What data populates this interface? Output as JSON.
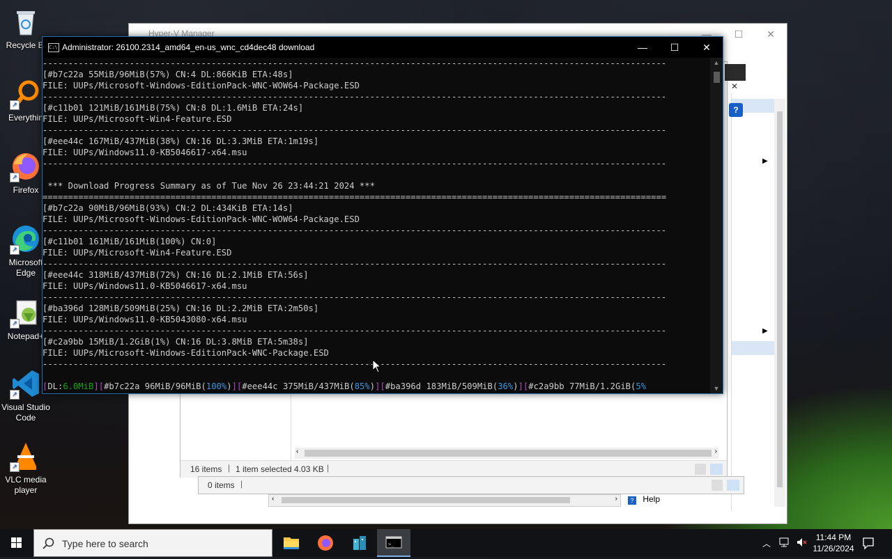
{
  "desktop": {
    "icons": [
      {
        "label": "Recycle Bi",
        "icon": "recycle-bin-icon"
      },
      {
        "label": "Everythin",
        "icon": "everything-search-icon"
      },
      {
        "label": "Firefox",
        "icon": "firefox-icon"
      },
      {
        "label": "Microsoft Edge",
        "icon": "edge-icon"
      },
      {
        "label": "Notepad+",
        "icon": "notepad-plus-icon"
      },
      {
        "label": "Visual Studio Code",
        "icon": "vscode-icon"
      },
      {
        "label": "VLC media player",
        "icon": "vlc-icon"
      }
    ]
  },
  "hyperv": {
    "title": "Hyper-V Manager",
    "status_items": "16 items",
    "status_selected": "1 item selected  4.03 KB",
    "status_items2": "0 items",
    "help_label": "Help"
  },
  "terminal": {
    "title": "Administrator:  26100.2314_amd64_en-us_wnc_cd4dec48 download",
    "lines": [
      "--------------------------------------------------------------------------------------------------------------------------",
      "[#b7c22a 55MiB/96MiB(57%) CN:4 DL:866KiB ETA:48s]",
      "FILE: UUPs/Microsoft-Windows-EditionPack-WNC-WOW64-Package.ESD",
      "--------------------------------------------------------------------------------------------------------------------------",
      "[#c11b01 121MiB/161MiB(75%) CN:8 DL:1.6MiB ETA:24s]",
      "FILE: UUPs/Microsoft-Win4-Feature.ESD",
      "--------------------------------------------------------------------------------------------------------------------------",
      "[#eee44c 167MiB/437MiB(38%) CN:16 DL:3.3MiB ETA:1m19s]",
      "FILE: UUPs/Windows11.0-KB5046617-x64.msu",
      "--------------------------------------------------------------------------------------------------------------------------",
      "",
      " *** Download Progress Summary as of Tue Nov 26 23:44:21 2024 ***",
      "==========================================================================================================================",
      "[#b7c22a 90MiB/96MiB(93%) CN:2 DL:434KiB ETA:14s]",
      "FILE: UUPs/Microsoft-Windows-EditionPack-WNC-WOW64-Package.ESD",
      "--------------------------------------------------------------------------------------------------------------------------",
      "[#c11b01 161MiB/161MiB(100%) CN:0]",
      "FILE: UUPs/Microsoft-Win4-Feature.ESD",
      "--------------------------------------------------------------------------------------------------------------------------",
      "[#eee44c 318MiB/437MiB(72%) CN:16 DL:2.1MiB ETA:56s]",
      "FILE: UUPs/Windows11.0-KB5046617-x64.msu",
      "--------------------------------------------------------------------------------------------------------------------------",
      "[#ba396d 128MiB/509MiB(25%) CN:16 DL:2.2MiB ETA:2m50s]",
      "FILE: UUPs/Windows11.0-KB5043080-x64.msu",
      "--------------------------------------------------------------------------------------------------------------------------",
      "[#c2a9bb 15MiB/1.2GiB(1%) CN:16 DL:3.8MiB ETA:5m38s]",
      "FILE: UUPs/Microsoft-Windows-EditionPack-WNC-Package.ESD",
      "--------------------------------------------------------------------------------------------------------------------------",
      ""
    ],
    "progress": {
      "dl_label": "DL:",
      "dl_value": "6.0MiB",
      "items": [
        {
          "id": "#b7c22a",
          "size": "96MiB/96MiB",
          "pct": "100%"
        },
        {
          "id": "#eee44c",
          "size": "375MiB/437MiB",
          "pct": "85%"
        },
        {
          "id": "#ba396d",
          "size": "183MiB/509MiB",
          "pct": "36%"
        },
        {
          "id": "#c2a9bb",
          "size": "77MiB/1.2GiB",
          "pct": "5%"
        }
      ]
    }
  },
  "taskbar": {
    "search_placeholder": "Type here to search",
    "time": "11:44 PM",
    "date": "11/26/2024"
  }
}
